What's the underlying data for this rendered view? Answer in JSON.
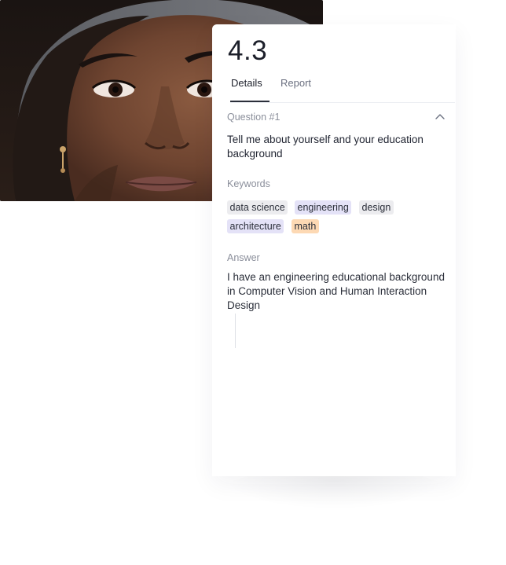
{
  "score": "4.3",
  "tabs": [
    {
      "label": "Details",
      "active": true
    },
    {
      "label": "Report",
      "active": false
    }
  ],
  "question": {
    "label": "Question #1",
    "text": "Tell me about yourself and your education background",
    "collapse_icon": "chevron-up-icon"
  },
  "keywords": {
    "label": "Keywords",
    "items": [
      {
        "text": "data science",
        "color": "#ececef"
      },
      {
        "text": "engineering",
        "color": "#e4e2f7"
      },
      {
        "text": "design",
        "color": "#ececef"
      },
      {
        "text": "architecture",
        "color": "#e4e2f7"
      },
      {
        "text": "math",
        "color": "#fdd9b4"
      }
    ]
  },
  "answer": {
    "label": "Answer",
    "text": "I have an engineering educational background in Computer Vision and Human Interaction Design"
  },
  "colors": {
    "chip_gray": "#ececef",
    "chip_purple": "#e4e2f7",
    "chip_orange": "#fdd9b4",
    "tab_underline": "#2b2f3a"
  }
}
